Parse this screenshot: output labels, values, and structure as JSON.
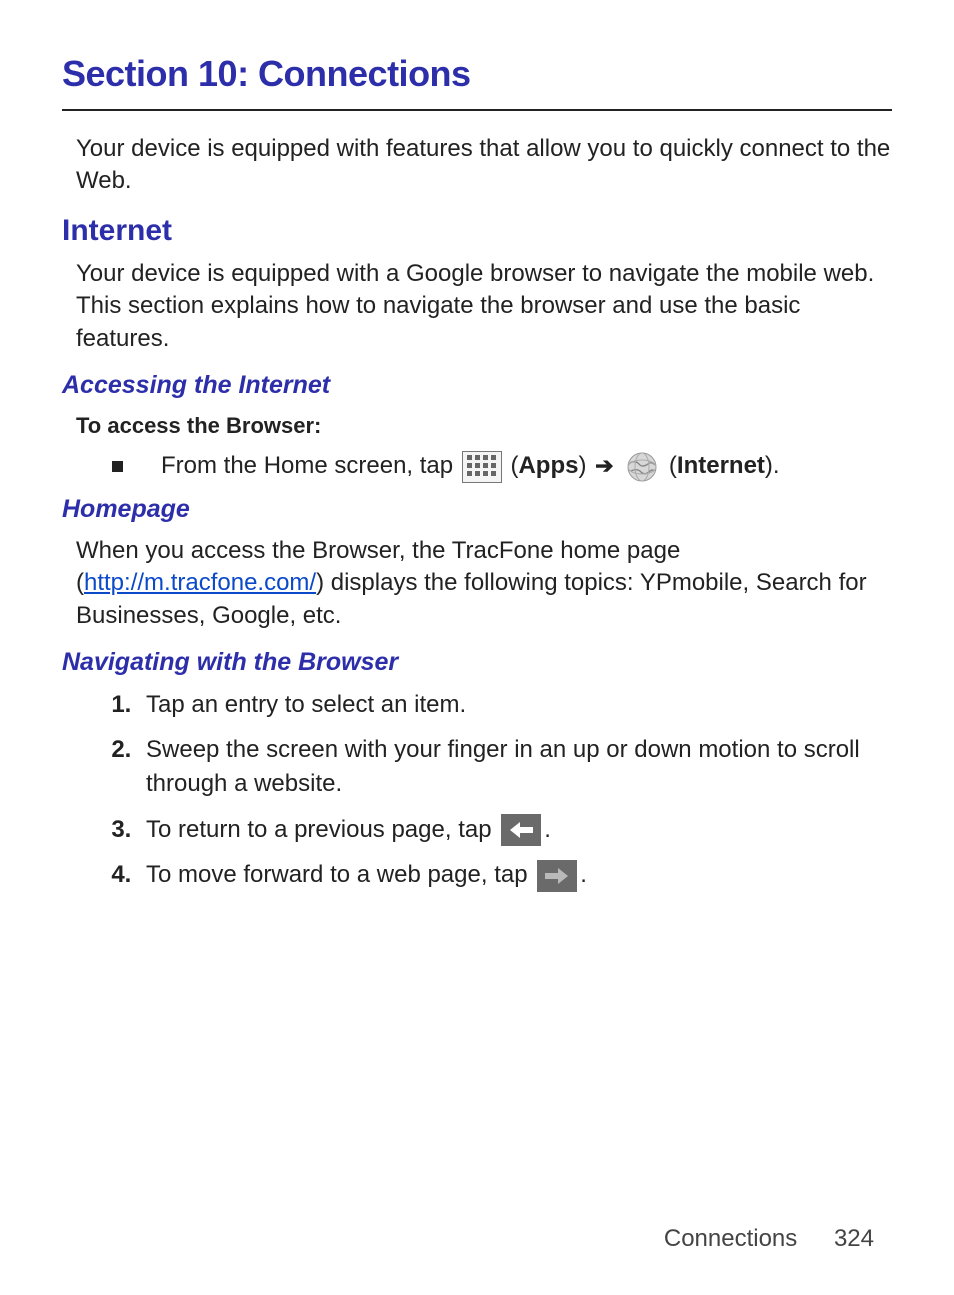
{
  "section_title": "Section 10: Connections",
  "intro": "Your device is equipped with features that allow you to quickly connect to the Web.",
  "internet": {
    "heading": "Internet",
    "para": "Your device is equipped with a Google browser to navigate the mobile web. This section explains how to navigate the browser and use the basic features."
  },
  "accessing": {
    "heading": "Accessing the Internet",
    "subhead": "To access the Browser:",
    "bullet_prefix": "From the Home screen, tap ",
    "apps_label": "Apps",
    "internet_label": "Internet"
  },
  "homepage": {
    "heading": "Homepage",
    "text_before_link": "When you access the Browser, the TracFone home page (",
    "link_text": "http://m.tracfone.com/",
    "text_after_link": ") displays the following topics: YPmobile, Search for Businesses, Google, etc."
  },
  "navigating": {
    "heading": "Navigating with the Browser",
    "steps": {
      "s1": "Tap an entry to select an item.",
      "s2": "Sweep the screen with your finger in an up or down motion to scroll through a website.",
      "s3_before": "To return to a previous page, tap ",
      "s3_after": ".",
      "s4_before": "To move forward to a web page, tap ",
      "s4_after": "."
    }
  },
  "footer": {
    "label": "Connections",
    "page": "324"
  }
}
